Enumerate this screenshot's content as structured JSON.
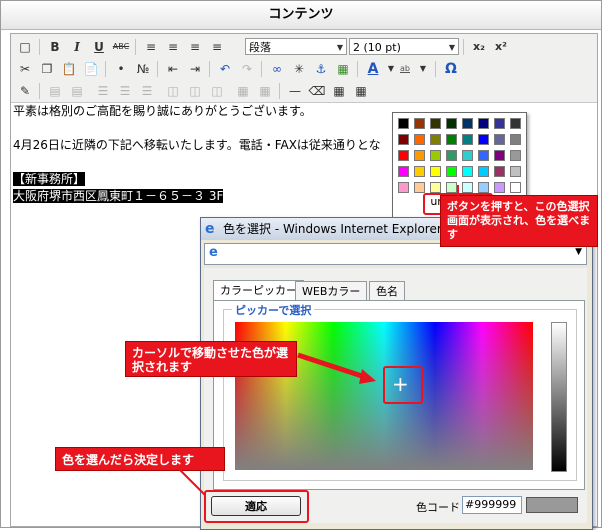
{
  "panel": {
    "title": "コンテンツ"
  },
  "toolbar": {
    "bold_label": "B",
    "italic_label": "I",
    "underline_label": "U",
    "strike_label": "ABC",
    "format_select": "段落",
    "size_select": "2 (10 pt)",
    "text_color_label": "A",
    "bg_color_label": "ab",
    "omega_label": "Ω",
    "subscript_label": "x₂",
    "superscript_label": "x²"
  },
  "content": {
    "line1": "平素は格別のご高配を賜り誠にありがとうございます。",
    "line2": "4月26日に近隣の下記へ移転いたします。電話・FAXは従来通りとな",
    "line3": "【新事務所】",
    "line4": "大阪府堺市西区鳳東町１－６５－３ 3F"
  },
  "palette": {
    "colors": [
      [
        "#000000",
        "#993300",
        "#333300",
        "#003300",
        "#003366",
        "#000080",
        "#333399",
        "#333333"
      ],
      [
        "#800000",
        "#FF6600",
        "#808000",
        "#008000",
        "#008080",
        "#0000FF",
        "#666699",
        "#808080"
      ],
      [
        "#FF0000",
        "#FF9900",
        "#99CC00",
        "#339966",
        "#33CCCC",
        "#3366FF",
        "#800080",
        "#999999"
      ],
      [
        "#FF00FF",
        "#FFCC00",
        "#FFFF00",
        "#00FF00",
        "#00FFFF",
        "#00CCFF",
        "#993366",
        "#C0C0C0"
      ],
      [
        "#FF99CC",
        "#FFCC99",
        "#FFFF99",
        "#CCFFCC",
        "#CCFFFF",
        "#99CCFF",
        "#CC99FF",
        "#FFFFFF"
      ]
    ],
    "undefined_label": "undefined"
  },
  "dialog": {
    "window_title": "色を選択 - Windows Internet Explorer",
    "tabs": [
      "カラーピッカー",
      "WEBカラー",
      "色名"
    ],
    "picker_legend": "ピッカーで選択",
    "apply_label": "適応",
    "color_code_label": "色コード",
    "color_code_value": "#999999",
    "preview_color": "#999999"
  },
  "annotations": {
    "palette_note": "ボタンを押すと、この色選択画面が表示され、色を選べます",
    "cursor_note": "カーソルで移動させた色が選択されます",
    "apply_note": "色を選んだら決定します"
  },
  "accent_color": "#e8141e"
}
